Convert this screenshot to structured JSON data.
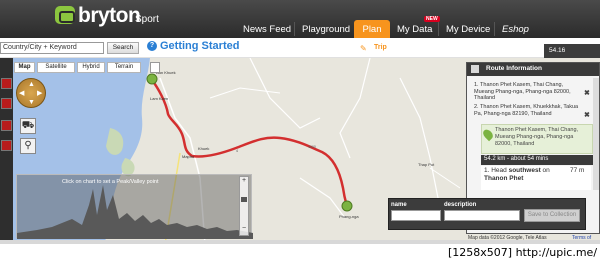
{
  "header": {
    "brand": "bryton",
    "brand_sub": "Sport",
    "nav": [
      {
        "label": "News Feed"
      },
      {
        "label": "Playground"
      },
      {
        "label": "Plan"
      },
      {
        "label": "My Data"
      },
      {
        "label": "My Device"
      },
      {
        "label": "Eshop"
      }
    ],
    "new_badge": "NEW"
  },
  "toolbar": {
    "search_placeholder": "Country/City + Keyword",
    "search_button": "Search",
    "getting_started": "Getting Started",
    "trip_label": "Trip",
    "distance": "54.16"
  },
  "map": {
    "types": [
      "Map",
      "Satellite",
      "Hybrid",
      "Terrain"
    ],
    "active_type": "Map",
    "elevation_caption": "Click on chart to set a Peak/Valley point",
    "places": [
      "Lam Kaen",
      "Thai Chang",
      "Phang-nga",
      "Thap Put",
      "Takua Pa",
      "Kok Kloi"
    ],
    "road_numbers": [
      "4",
      "4090",
      "4",
      "4090"
    ],
    "route_color": "#d32f2f",
    "map_data": "Map data ©2012 Google, Tele Atlas",
    "terms": "Terms of Use"
  },
  "route": {
    "title": "Route Information",
    "waypoints": [
      {
        "num": "1.",
        "text": "Thanon Phet Kasem, Thai Chang, Mueang Phang-nga, Phang-nga 82000, Thailand"
      },
      {
        "num": "2.",
        "text": "Thanon Phet Kasem, Khuekkhak, Takua Pa, Phang-nga 82190, Thailand"
      }
    ],
    "end_text": "Thanon Phet Kasem, Thai Chang, Mueang Phang-nga, Phang-nga 82000, Thailand",
    "summary": "54.2 km - about 54 mins",
    "step": {
      "num": "1.",
      "text_a": "Head ",
      "direction": "southwest",
      "text_b": " on ",
      "road": "Thanon Phet",
      "distance": "77 m"
    }
  },
  "save": {
    "name_label": "name",
    "description_label": "description",
    "button": "Save to Collection"
  },
  "watermark": "[1258x507] http://upic.me/"
}
